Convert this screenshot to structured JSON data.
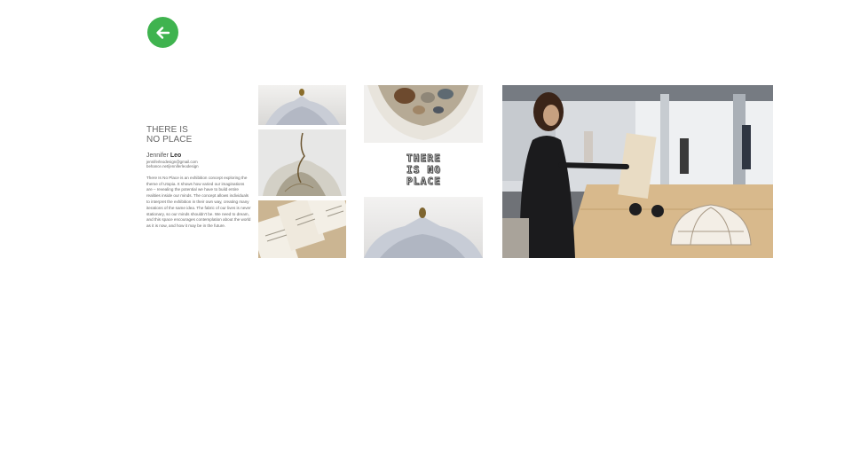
{
  "nav": {
    "back_label": "Back"
  },
  "project": {
    "title_line1": "THERE IS",
    "title_line2": "NO PLACE",
    "author_first": "Jennifer",
    "author_last": "Leo",
    "email": "jenniferleodesign@gmail.com",
    "behance": "behance.net/jenniferleodesign",
    "description": "There Is No Place is an exhibition concept exploring the theme of Utopia. It shows how varied our imaginations are – revealing the potential we have to build entire realities inside our minds. The concept allows individuals to interpret the exhibition in their own way, creating many iterations of the same idea. The fabric of our lives is never stationary, so our minds shouldn't be. We need to dream, and this space encourages contemplation about the world as it is now, and how it may be in the future."
  },
  "gallery": {
    "typography_lines": [
      "THERE",
      "IS NO",
      "PLACE"
    ]
  },
  "colors": {
    "accent": "#3fb34f",
    "text": "#666666",
    "background": "#ffffff"
  }
}
